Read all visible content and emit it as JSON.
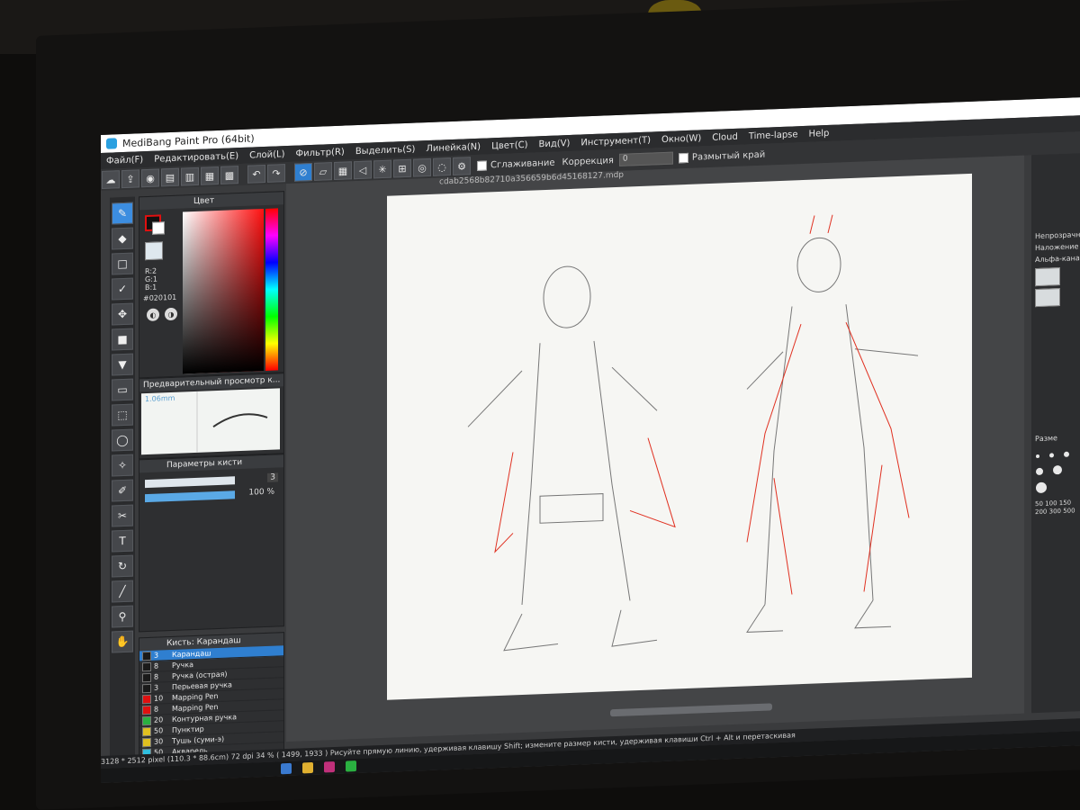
{
  "window": {
    "title": "MediBang Paint Pro (64bit)"
  },
  "menu": [
    "Файл(F)",
    "Редактировать(E)",
    "Слой(L)",
    "Фильтр(R)",
    "Выделить(S)",
    "Линейка(N)",
    "Цвет(C)",
    "Вид(V)",
    "Инструмент(T)",
    "Окно(W)",
    "Cloud",
    "Time-lapse",
    "Help"
  ],
  "toolbar": {
    "antialias_label": "Сглаживание",
    "correction_label": "Коррекция",
    "correction_value": "0",
    "blur_edge_label": "Размытый край"
  },
  "color_panel": {
    "title": "Цвет",
    "r": "R:2",
    "g": "G:1",
    "b": "B:1",
    "hex": "#020101",
    "fg_color": "#020101",
    "accent": "#e01010"
  },
  "brush_preview": {
    "title": "Предварительный просмотр к...",
    "size": "1.06mm"
  },
  "brush_params": {
    "title": "Параметры кисти",
    "size_value": "3",
    "opacity_value": "100 %",
    "opacity": 1.0
  },
  "brush_list": {
    "title": "Кисть: Карандаш",
    "items": [
      {
        "size": "3",
        "name": "Карандаш",
        "color": "#1a1a1a",
        "selected": true
      },
      {
        "size": "8",
        "name": "Ручка",
        "color": "#1a1a1a",
        "selected": false
      },
      {
        "size": "8",
        "name": "Ручка (острая)",
        "color": "#1a1a1a",
        "selected": false
      },
      {
        "size": "3",
        "name": "Перьевая ручка",
        "color": "#1a1a1a",
        "selected": false
      },
      {
        "size": "10",
        "name": "Mapping Pen",
        "color": "#e01010",
        "selected": false
      },
      {
        "size": "8",
        "name": "Mapping Pen",
        "color": "#e01010",
        "selected": false
      },
      {
        "size": "20",
        "name": "Контурная ручка",
        "color": "#2ab040",
        "selected": false
      },
      {
        "size": "50",
        "name": "Пунктир",
        "color": "#e0c020",
        "selected": false
      },
      {
        "size": "30",
        "name": "Тушь (суми-э)",
        "color": "#e0c020",
        "selected": false
      },
      {
        "size": "50",
        "name": "Акварель",
        "color": "#30c0e0",
        "selected": false
      }
    ]
  },
  "canvas": {
    "filename": "cdab2568b82710a356659b6d45168127.mdp"
  },
  "right_panel": {
    "opacity_label": "Непрозрачн",
    "blend_label": "Наложение",
    "alpha_label": "Альфа-кана",
    "size_label": "Разме",
    "size_values": [
      "50",
      "100",
      "150",
      "200",
      "300",
      "500"
    ]
  },
  "status": {
    "dimensions": "3128 * 2512 pixel",
    "physical": "(110.3 * 88.6cm)",
    "dpi": "72 dpi",
    "zoom": "34 %",
    "coords": "( 1499, 1933 )",
    "hint": "Рисуйте прямую линию, удерживая клавишу Shift; измените размер кисти, удерживая клавиши Ctrl + Alt и перетаскивая"
  }
}
